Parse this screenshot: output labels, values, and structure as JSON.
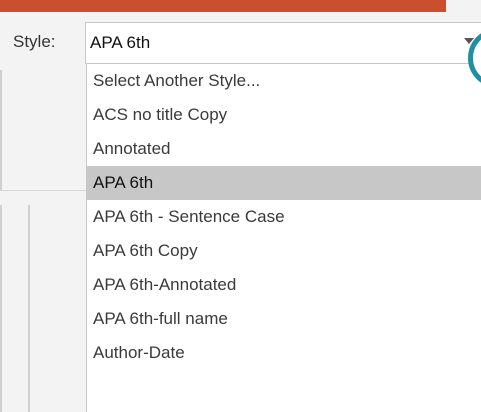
{
  "style_label": "Style:",
  "selected_style": "APA 6th",
  "dropdown_items": [
    {
      "label": "Select Another Style...",
      "selected": false
    },
    {
      "label": "ACS no title Copy",
      "selected": false
    },
    {
      "label": "Annotated",
      "selected": false
    },
    {
      "label": "APA 6th",
      "selected": true
    },
    {
      "label": "APA 6th - Sentence Case",
      "selected": false
    },
    {
      "label": "APA 6th Copy",
      "selected": false
    },
    {
      "label": "APA 6th-Annotated",
      "selected": false
    },
    {
      "label": "APA 6th-full name",
      "selected": false
    },
    {
      "label": "Author-Date",
      "selected": false
    }
  ],
  "colors": {
    "accent_bar": "#c9502f",
    "selected_row": "#c7c7c7",
    "teal_marker": "#1f8fa3"
  }
}
